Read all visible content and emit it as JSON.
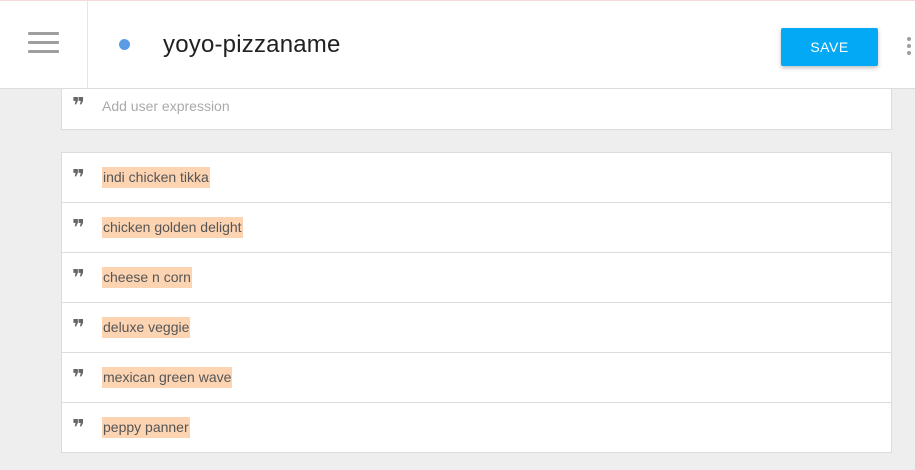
{
  "header": {
    "title": "yoyo-pizzaname",
    "save_label": "SAVE",
    "status_dot_color": "#5b9be6",
    "accent_color": "#03a9f4"
  },
  "expression_input": {
    "placeholder": "Add user expression",
    "value": ""
  },
  "expressions": [
    {
      "text": "indi chicken tikka"
    },
    {
      "text": "chicken golden delight"
    },
    {
      "text": "cheese n corn"
    },
    {
      "text": "deluxe veggie"
    },
    {
      "text": "mexican green wave"
    },
    {
      "text": "peppy panner"
    }
  ],
  "highlight_color": "#fcd4b2",
  "icons": {
    "menu": "hamburger-menu-icon",
    "quote": "format-quote-icon",
    "more": "more-vertical-icon"
  }
}
